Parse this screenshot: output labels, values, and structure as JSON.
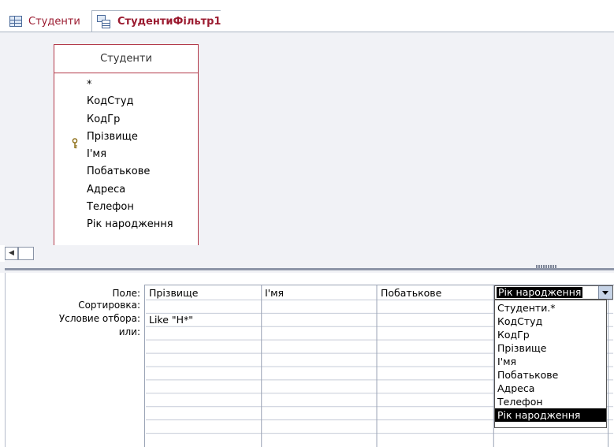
{
  "tabs": [
    {
      "label": "Студенти",
      "icon": "table-icon"
    },
    {
      "label": "СтудентиФільтр1",
      "icon": "query-icon"
    }
  ],
  "field_list": {
    "title": "Студенти",
    "fields": [
      "*",
      "КодСтуд",
      "КодГр",
      "Прізвище",
      "І'мя",
      "Побатькове",
      "Адреса",
      "Телефон",
      "Рік народження"
    ],
    "key_field": "КодСтуд"
  },
  "grid": {
    "row_labels": {
      "field": "Поле:",
      "sort": "Сортировка:",
      "criteria": "Условие отбора:",
      "or": "или:"
    },
    "columns": [
      {
        "field": "Прізвище",
        "criteria": "Like \"Н*\""
      },
      {
        "field": "І'мя",
        "criteria": ""
      },
      {
        "field": "Побатькове",
        "criteria": ""
      },
      {
        "field": "Рік народження",
        "criteria": ""
      }
    ]
  },
  "dropdown": {
    "selected": "Рік народження",
    "options": [
      "Студенти.*",
      "КодСтуд",
      "КодГр",
      "Прізвище",
      "І'мя",
      "Побатькове",
      "Адреса",
      "Телефон",
      "Рік народження"
    ],
    "highlighted": "Рік народження"
  },
  "colors": {
    "tab_text": "#9b1b30",
    "field_list_border": "#b33a4a",
    "designer_background": "#f1f2f6",
    "selection": "#000000"
  }
}
